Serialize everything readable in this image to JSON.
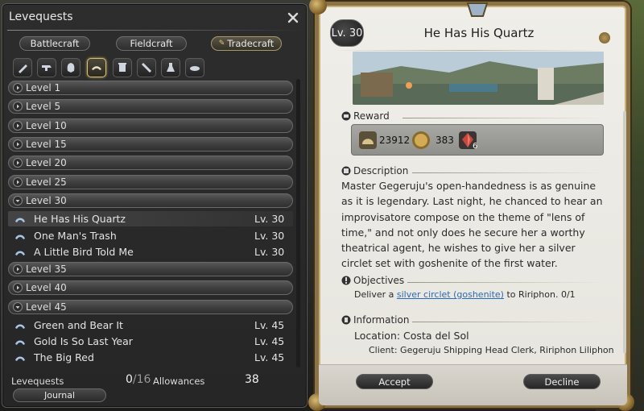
{
  "left_window": {
    "title": "Levequests",
    "tabs": [
      {
        "label": "Battlecraft",
        "active": false
      },
      {
        "label": "Fieldcraft",
        "active": false
      },
      {
        "label": "Tradecraft",
        "active": true
      }
    ],
    "class_icons": [
      {
        "name": "carpenter-icon",
        "active": false
      },
      {
        "name": "blacksmith-icon",
        "active": false
      },
      {
        "name": "armorer-icon",
        "active": false
      },
      {
        "name": "goldsmith-icon",
        "active": true
      },
      {
        "name": "leatherworker-icon",
        "active": false
      },
      {
        "name": "weaver-icon",
        "active": false
      },
      {
        "name": "alchemist-icon",
        "active": false
      },
      {
        "name": "culinarian-icon",
        "active": false
      }
    ],
    "list": [
      {
        "kind": "level",
        "label": "Level 1",
        "expanded": false
      },
      {
        "kind": "level",
        "label": "Level 5",
        "expanded": false
      },
      {
        "kind": "level",
        "label": "Level 10",
        "expanded": false
      },
      {
        "kind": "level",
        "label": "Level 15",
        "expanded": false
      },
      {
        "kind": "level",
        "label": "Level 20",
        "expanded": false
      },
      {
        "kind": "level",
        "label": "Level 25",
        "expanded": false
      },
      {
        "kind": "level",
        "label": "Level 30",
        "expanded": true
      },
      {
        "kind": "quest",
        "name": "He Has His Quartz",
        "level": "Lv. 30",
        "selected": true
      },
      {
        "kind": "quest",
        "name": "One Man's Trash",
        "level": "Lv. 30",
        "selected": false
      },
      {
        "kind": "quest",
        "name": "A Little Bird Told Me",
        "level": "Lv. 30",
        "selected": false
      },
      {
        "kind": "level",
        "label": "Level 35",
        "expanded": false
      },
      {
        "kind": "level",
        "label": "Level 40",
        "expanded": false
      },
      {
        "kind": "level",
        "label": "Level 45",
        "expanded": true
      },
      {
        "kind": "quest",
        "name": "Green and Bear It",
        "level": "Lv. 45",
        "selected": false
      },
      {
        "kind": "quest",
        "name": "Gold Is So Last Year",
        "level": "Lv. 45",
        "selected": false
      },
      {
        "kind": "quest",
        "name": "The Big Red",
        "level": "Lv. 45",
        "selected": false
      }
    ],
    "footer": {
      "levequests_label": "Levequests",
      "levequests_current": "0",
      "levequests_max": "/16",
      "allowances_label": "Allowances",
      "allowances_value": "38",
      "journal_label": "Journal"
    }
  },
  "detail": {
    "level_badge": "Lv. 30",
    "title": "He Has His Quartz",
    "reward_header": "Reward",
    "rewards": [
      {
        "icon": "exp-icon",
        "value": "23912"
      },
      {
        "icon": "gil-icon",
        "value": "383"
      },
      {
        "icon": "crystal-icon",
        "value": "6"
      }
    ],
    "description_header": "Description",
    "description": "Master Gegeruju's open-handedness is as genuine as it is legendary. Last night, he chanced to hear an improvisatore compose on the theme of \"lens of time,\" and not only does he secure her a worthy theatrical agent, he wishes to give her a silver circlet set with goshenite of the first water.",
    "objectives_header": "Objectives",
    "objective_prefix": "Deliver a ",
    "objective_item": "silver circlet (goshenite)",
    "objective_suffix": " to Ririphon. 0/1",
    "information_header": "Information",
    "location": "Location: Costa del Sol",
    "client": "Client: Gegeruju Shipping Head Clerk, Ririphon Liliphon",
    "accept_label": "Accept",
    "decline_label": "Decline"
  },
  "colors": {
    "link": "#2a6ab8",
    "frame_gold": "#8c7346",
    "panel_bg": "#efeee9"
  }
}
